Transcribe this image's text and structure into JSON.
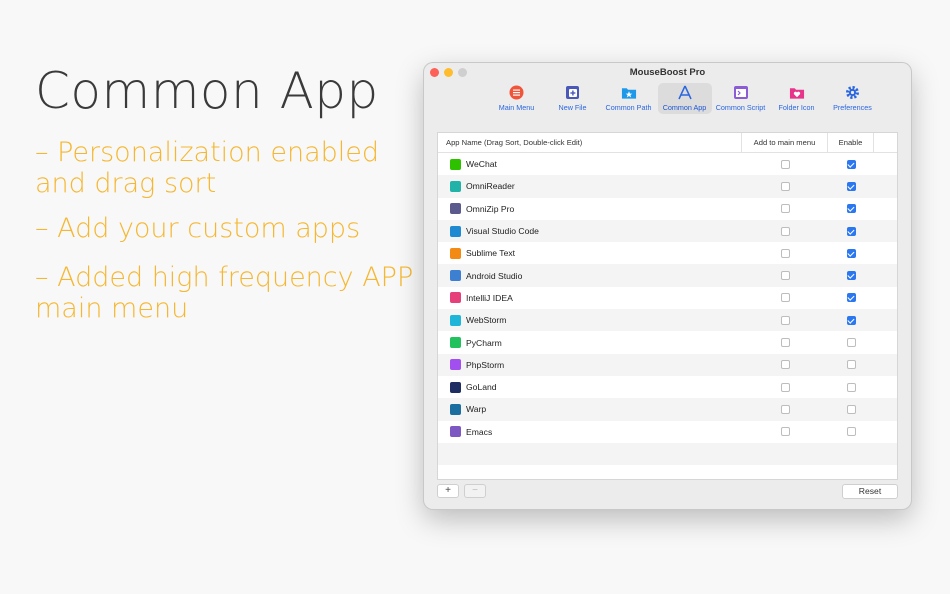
{
  "promo": {
    "headline": "Common App",
    "bullets": [
      [
        "– Personalization enabled",
        "and drag sort"
      ],
      [
        "– Add your custom apps"
      ],
      [
        "– Added high frequency APP to",
        "main menu"
      ]
    ]
  },
  "window": {
    "title": "MouseBoost Pro",
    "toolbar": [
      {
        "label": "Main Menu",
        "icon": "list-icon"
      },
      {
        "label": "New File",
        "icon": "new-file-icon"
      },
      {
        "label": "Common Path",
        "icon": "folder-star-icon"
      },
      {
        "label": "Common App",
        "icon": "app-store-icon"
      },
      {
        "label": "Common Script",
        "icon": "terminal-icon"
      },
      {
        "label": "Folder Icon",
        "icon": "folder-heart-icon"
      },
      {
        "label": "Preferences",
        "icon": "gear-icon"
      }
    ],
    "active_tab": "Common App",
    "table": {
      "columns": [
        "App Name (Drag Sort, Double-click Edit)",
        "Add to main menu",
        "Enable"
      ],
      "rows": [
        {
          "name": "WeChat",
          "icon_color": "#2dc100",
          "add_to_main": false,
          "enable": true
        },
        {
          "name": "OmniReader",
          "icon_color": "#21b3a8",
          "add_to_main": false,
          "enable": true
        },
        {
          "name": "OmniZip Pro",
          "icon_color": "#5a5a8c",
          "add_to_main": false,
          "enable": true
        },
        {
          "name": "Visual Studio Code",
          "icon_color": "#1f8ad2",
          "add_to_main": false,
          "enable": true
        },
        {
          "name": "Sublime Text",
          "icon_color": "#f38a14",
          "add_to_main": false,
          "enable": true
        },
        {
          "name": "Android Studio",
          "icon_color": "#3d7fd0",
          "add_to_main": false,
          "enable": true
        },
        {
          "name": "IntelliJ IDEA",
          "icon_color": "#e63f7a",
          "add_to_main": false,
          "enable": true
        },
        {
          "name": "WebStorm",
          "icon_color": "#1fb5d8",
          "add_to_main": false,
          "enable": true
        },
        {
          "name": "PyCharm",
          "icon_color": "#21c25e",
          "add_to_main": false,
          "enable": false
        },
        {
          "name": "PhpStorm",
          "icon_color": "#a24ff0",
          "add_to_main": false,
          "enable": false
        },
        {
          "name": "GoLand",
          "icon_color": "#1f2e62",
          "add_to_main": false,
          "enable": false
        },
        {
          "name": "Warp",
          "icon_color": "#1b6fa0",
          "add_to_main": false,
          "enable": false
        },
        {
          "name": "Emacs",
          "icon_color": "#7e58c2",
          "add_to_main": false,
          "enable": false
        }
      ]
    },
    "buttons": {
      "add": "+",
      "remove": "−",
      "reset": "Reset"
    }
  }
}
